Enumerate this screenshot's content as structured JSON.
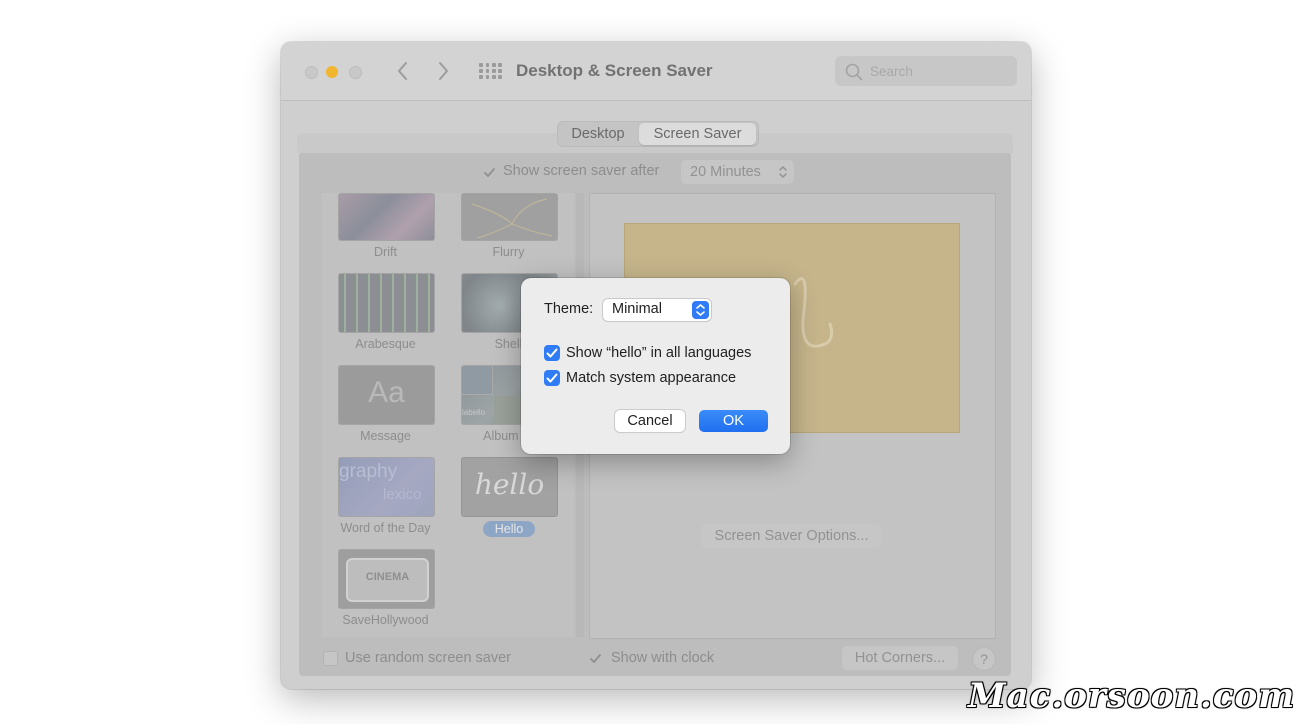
{
  "window": {
    "title": "Desktop & Screen Saver",
    "search_placeholder": "Search"
  },
  "tabs": [
    {
      "label": "Desktop",
      "selected": false
    },
    {
      "label": "Screen Saver",
      "selected": true
    }
  ],
  "show_after": {
    "label": "Show screen saver after",
    "checked": true,
    "value": "20 Minutes"
  },
  "savers": [
    {
      "label": "Drift",
      "selected": false
    },
    {
      "label": "Flurry",
      "selected": false
    },
    {
      "label": "Arabesque",
      "selected": false
    },
    {
      "label": "Shell",
      "selected": false
    },
    {
      "label": "Message",
      "selected": false
    },
    {
      "label": "Album Ar",
      "selected": false
    },
    {
      "label": "Word of the Day",
      "selected": false
    },
    {
      "label": "Hello",
      "selected": true
    },
    {
      "label": "SaveHollywood",
      "selected": false
    }
  ],
  "thumb_text": {
    "message": "Aa",
    "word1": "graphy",
    "word2": "lexico",
    "hello": "hello",
    "cinema": "CINEMA",
    "album_tile": "labello"
  },
  "options_button": "Screen Saver Options...",
  "bottom": {
    "random": {
      "label": "Use random screen saver",
      "checked": false
    },
    "clock": {
      "label": "Show with clock",
      "checked": true
    },
    "hot_corners": "Hot Corners...",
    "help": "?"
  },
  "dialog": {
    "theme_label": "Theme:",
    "theme_value": "Minimal",
    "options": [
      {
        "label": "Show “hello” in all languages",
        "checked": true
      },
      {
        "label": "Match system appearance",
        "checked": true
      }
    ],
    "cancel": "Cancel",
    "ok": "OK"
  },
  "watermark": "Mac.orsoon.com",
  "colors": {
    "accent": "#2f7cf6",
    "traffic_min": "#f1b62f",
    "preview_bg": "#c6b58b"
  }
}
